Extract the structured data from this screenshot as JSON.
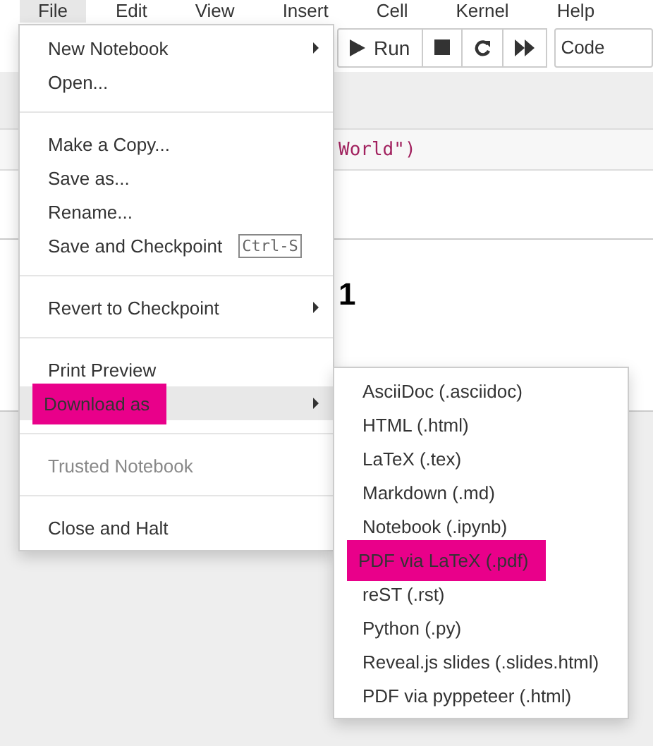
{
  "menubar": [
    {
      "label": "File",
      "selected": true
    },
    {
      "label": "Edit",
      "selected": false
    },
    {
      "label": "View",
      "selected": false
    },
    {
      "label": "Insert",
      "selected": false
    },
    {
      "label": "Cell",
      "selected": false
    },
    {
      "label": "Kernel",
      "selected": false
    },
    {
      "label": "Help",
      "selected": false
    }
  ],
  "toolbar": {
    "run_label": "Run",
    "cell_type": "Code"
  },
  "code_text": "World\")",
  "heading_text": "1",
  "file_menu": [
    {
      "kind": "item",
      "label": "New Notebook",
      "submenu": true,
      "selected": false,
      "disabled": false,
      "marked": false
    },
    {
      "kind": "item",
      "label": "Open...",
      "submenu": false,
      "selected": false,
      "disabled": false,
      "marked": false
    },
    {
      "kind": "divider"
    },
    {
      "kind": "item",
      "label": "Make a Copy...",
      "submenu": false,
      "selected": false,
      "disabled": false,
      "marked": false
    },
    {
      "kind": "item",
      "label": "Save as...",
      "submenu": false,
      "selected": false,
      "disabled": false,
      "marked": false
    },
    {
      "kind": "item",
      "label": "Rename...",
      "submenu": false,
      "selected": false,
      "disabled": false,
      "marked": false
    },
    {
      "kind": "item",
      "label": "Save and Checkpoint",
      "shortcut": "Ctrl-S",
      "submenu": false,
      "selected": false,
      "disabled": false,
      "marked": false
    },
    {
      "kind": "divider"
    },
    {
      "kind": "item",
      "label": "Revert to Checkpoint",
      "submenu": true,
      "selected": false,
      "disabled": false,
      "marked": false
    },
    {
      "kind": "divider"
    },
    {
      "kind": "item",
      "label": "Print Preview",
      "submenu": false,
      "selected": false,
      "disabled": false,
      "marked": false
    },
    {
      "kind": "item",
      "label": "Download as",
      "submenu": true,
      "selected": true,
      "disabled": false,
      "marked": true
    },
    {
      "kind": "divider"
    },
    {
      "kind": "item",
      "label": "Trusted Notebook",
      "submenu": false,
      "selected": false,
      "disabled": true,
      "marked": false
    },
    {
      "kind": "divider"
    },
    {
      "kind": "item",
      "label": "Close and Halt",
      "submenu": false,
      "selected": false,
      "disabled": false,
      "marked": false
    }
  ],
  "download_menu": [
    {
      "label": "AsciiDoc (.asciidoc)",
      "marked": false
    },
    {
      "label": "HTML (.html)",
      "marked": false
    },
    {
      "label": "LaTeX (.tex)",
      "marked": false
    },
    {
      "label": "Markdown (.md)",
      "marked": false
    },
    {
      "label": "Notebook (.ipynb)",
      "marked": false
    },
    {
      "label": "PDF via LaTeX (.pdf)",
      "marked": true
    },
    {
      "label": "reST (.rst)",
      "marked": false
    },
    {
      "label": "Python (.py)",
      "marked": false
    },
    {
      "label": "Reveal.js slides (.slides.html)",
      "marked": false
    },
    {
      "label": "PDF via pyppeteer (.html)",
      "marked": false
    }
  ]
}
